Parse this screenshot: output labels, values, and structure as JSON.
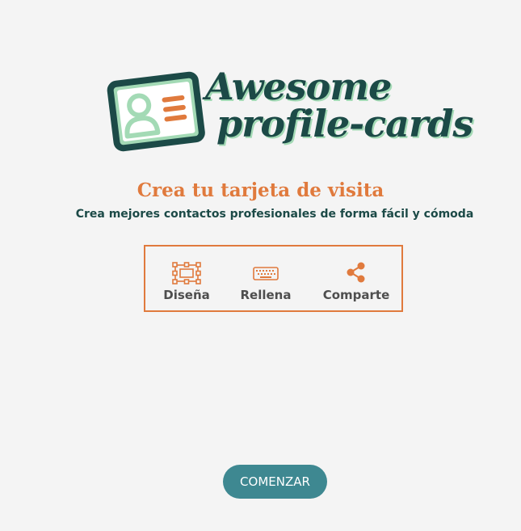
{
  "logo": {
    "line1": "Awesome",
    "line2": "profile-cards"
  },
  "hero": {
    "title": "Crea tu tarjeta de visita",
    "subtitle": "Crea mejores contactos profesionales de forma fácil y cómoda"
  },
  "steps": [
    {
      "label": "Diseña",
      "icon": "design-frame-icon"
    },
    {
      "label": "Rellena",
      "icon": "keyboard-icon"
    },
    {
      "label": "Comparte",
      "icon": "share-icon"
    }
  ],
  "start_button": {
    "label": "COMENZAR"
  },
  "colors": {
    "background": "#f4f4f4",
    "brand_dark": "#1c4a47",
    "brand_light": "#a3dab5",
    "accent": "#e07a3d",
    "button": "#3e8891",
    "step_label": "#4e4e4e"
  }
}
